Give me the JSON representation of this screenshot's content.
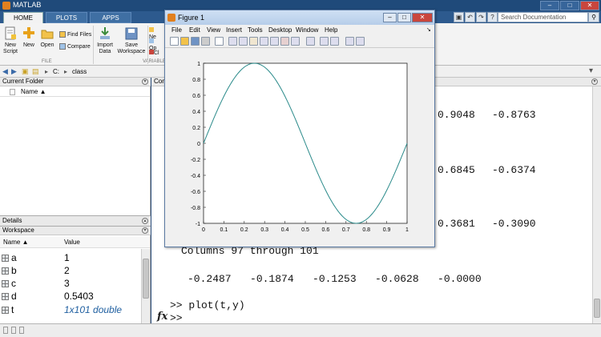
{
  "app": {
    "title": "MATLAB"
  },
  "tabs": [
    "HOME",
    "PLOTS",
    "APPS"
  ],
  "search": {
    "placeholder": "Search Documentation"
  },
  "toolstrip": {
    "new_script": "New Script",
    "new": "New",
    "open": "Open",
    "find_files": "Find Files",
    "compare": "Compare",
    "import_data": "Import Data",
    "save_workspace": "Save Workspace",
    "ne_clip": "Ne",
    "op_clip": "Op",
    "cl_clip": "Cl",
    "section_file": "FILE",
    "section_variable": "VARIABLE"
  },
  "path": {
    "drive": "C:",
    "folder": "class"
  },
  "current_folder": {
    "title": "Current Folder",
    "name_col": "Name ▲"
  },
  "details": {
    "title": "Details"
  },
  "workspace": {
    "title": "Workspace",
    "name_col": "Name ▲",
    "value_col": "Value",
    "variables": [
      {
        "name": "a",
        "value": "1"
      },
      {
        "name": "b",
        "value": "2"
      },
      {
        "name": "c",
        "value": "3"
      },
      {
        "name": "d",
        "value": "0.5403"
      },
      {
        "name": "t",
        "value": "1x101 double"
      }
    ]
  },
  "command_window": {
    "title": "Comma",
    "rows": [
      {
        "c1": "0.9048",
        "c2": "-0.8763"
      },
      {
        "c1": "0.6845",
        "c2": "-0.6374"
      },
      {
        "c1": "0.3681",
        "c2": "-0.3090"
      }
    ],
    "columns_line": "Columns 97 through 101",
    "last_values": "-0.2487   -0.1874   -0.1253   -0.0628   -0.0000",
    "command": ">> plot(t,y)",
    "prompt": ">>",
    "fx": "fx"
  },
  "figure": {
    "title": "Figure 1",
    "menu": [
      "File",
      "Edit",
      "View",
      "Insert",
      "Tools",
      "Desktop",
      "Window",
      "Help"
    ]
  },
  "chart_data": {
    "type": "line",
    "xlim": [
      0,
      1
    ],
    "ylim": [
      -1,
      1
    ],
    "xticks": [
      "0",
      "0.1",
      "0.2",
      "0.3",
      "0.4",
      "0.5",
      "0.6",
      "0.7",
      "0.8",
      "0.9",
      "1"
    ],
    "yticks": [
      "1",
      "0.8",
      "0.6",
      "0.4",
      "0.2",
      "0",
      "-0.2",
      "-0.4",
      "-0.6",
      "-0.8",
      "-1"
    ],
    "series": [
      {
        "function": "sin(2*pi*t)",
        "samples": 101,
        "color": "#2a8a8a"
      }
    ],
    "grid": false
  },
  "colors": {
    "accent": "#1f4a7a",
    "line": "#2a8a8a"
  }
}
